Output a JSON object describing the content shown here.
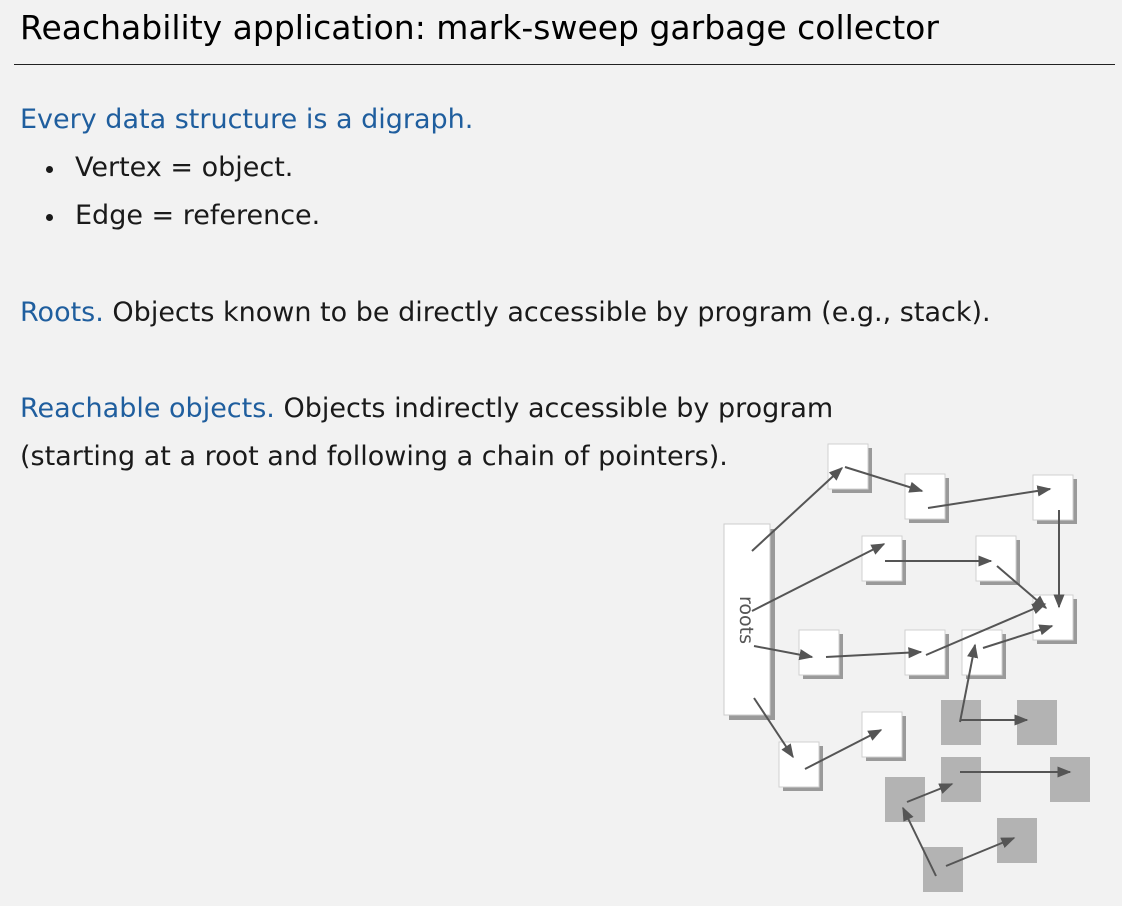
{
  "title": "Reachability application:  mark-sweep garbage collector",
  "section_1": {
    "heading": "Every data structure is a digraph.",
    "bullets": [
      "Vertex = object.",
      "Edge = reference."
    ]
  },
  "section_2": {
    "term": "Roots.",
    "text": "Objects known to be directly accessible by program (e.g., stack)."
  },
  "section_3": {
    "term": "Reachable objects.",
    "text_line_1": "Objects indirectly accessible by program",
    "text_line_2": "(starting at a root and following a chain of pointers)."
  },
  "diagram": {
    "roots_label": "roots",
    "colors": {
      "reachable_fill": "#ffffff",
      "unreachable_fill": "#b3b3b3",
      "edge": "#555555",
      "shadow": "#9a9a9a",
      "accent_text": "#1f5e9e"
    }
  }
}
